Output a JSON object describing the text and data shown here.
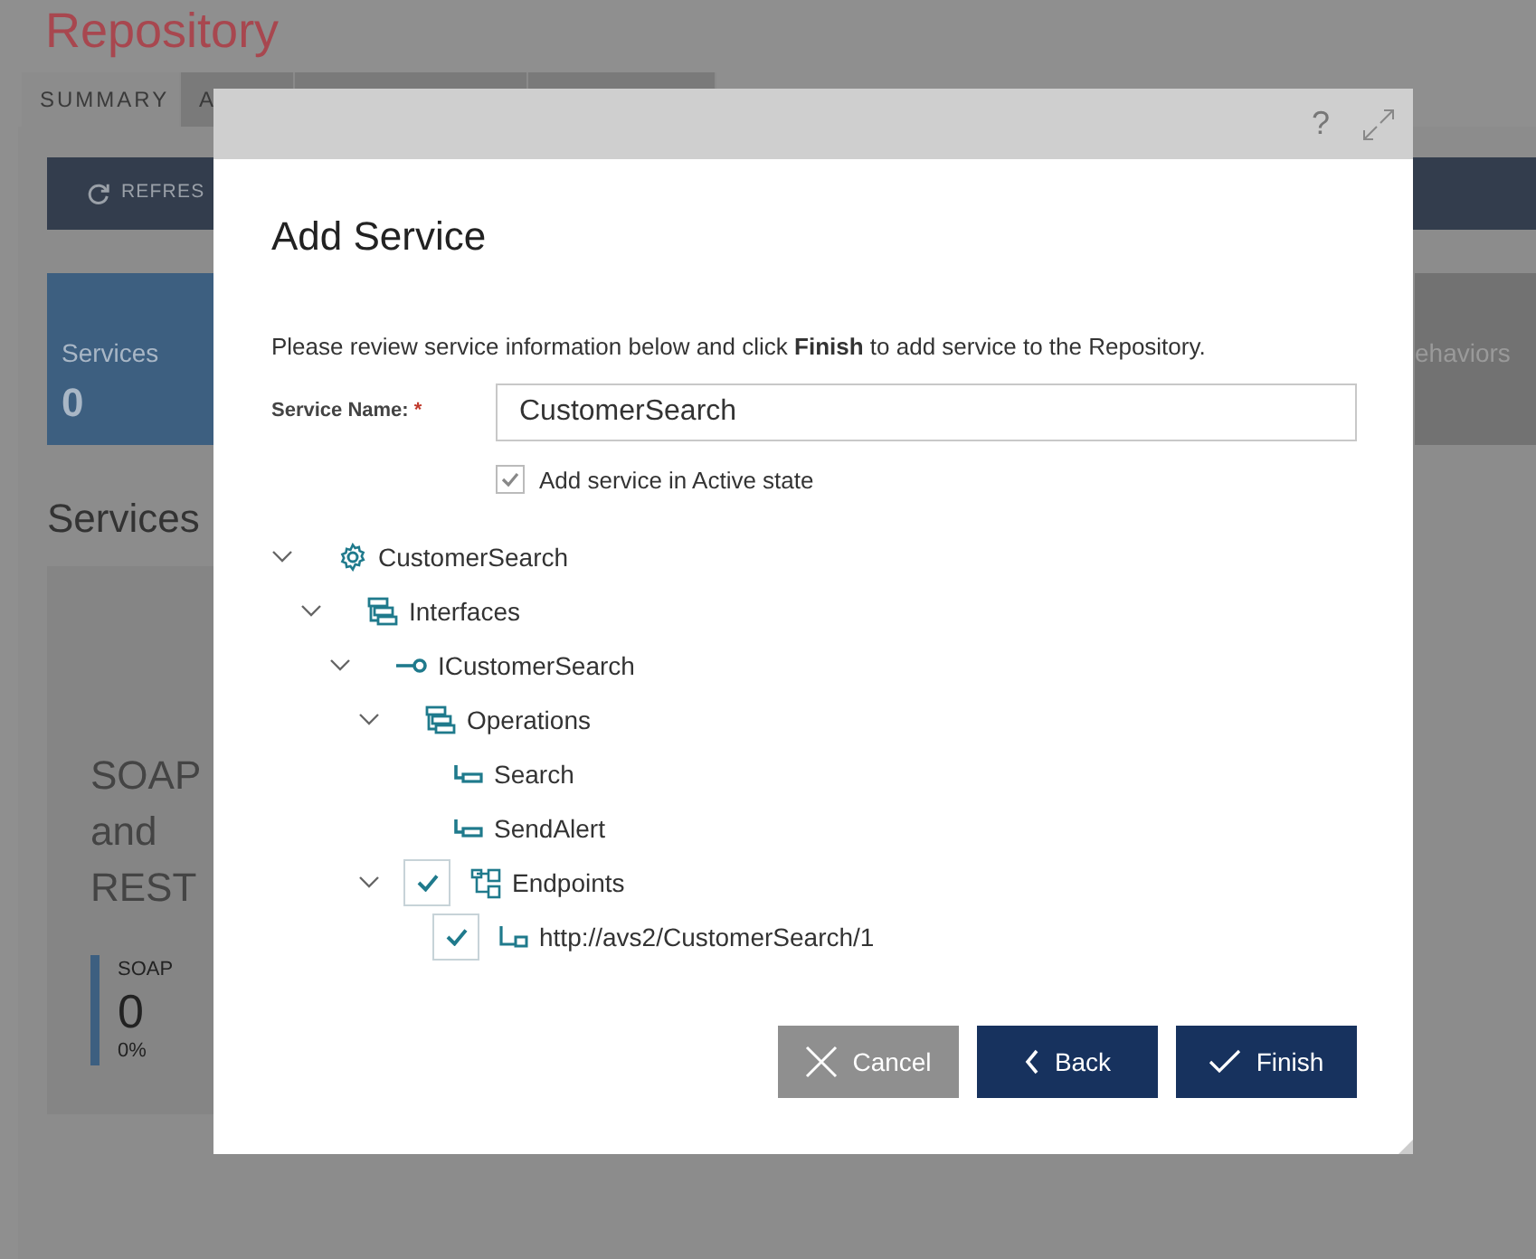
{
  "page": {
    "title": "Repository",
    "tabs": [
      {
        "label": "SUMMARY",
        "selected": true
      },
      {
        "label": "A",
        "selected": false
      },
      {
        "selected": false
      },
      {
        "selected": false
      }
    ],
    "toolbar": {
      "refresh_label": "REFRES"
    },
    "tiles": [
      {
        "label": "Services",
        "value": "0",
        "color": "#3d5f80"
      },
      {
        "label": "ehaviors",
        "color": "#727272"
      }
    ],
    "section_title": "Services",
    "card": {
      "title": "SOAP and REST",
      "stat": {
        "label": "SOAP",
        "value": "0",
        "percent": "0%"
      }
    }
  },
  "dialog": {
    "help": "?",
    "title": "Add Service",
    "message": "Please review service information below and click **Finish** to add service to the Repository.",
    "field": {
      "label": "Service Name:",
      "required_mark": "*",
      "value": "CustomerSearch"
    },
    "active_checkbox": {
      "label": "Add service in Active state",
      "checked": true
    },
    "tree": [
      {
        "label": "CustomerSearch",
        "kind": "service",
        "expanded": true,
        "children": [
          {
            "label": "Interfaces",
            "kind": "folder",
            "expanded": true,
            "children": [
              {
                "label": "ICustomerSearch",
                "kind": "interface",
                "expanded": true,
                "children": [
                  {
                    "label": "Operations",
                    "kind": "folder",
                    "expanded": true,
                    "children": [
                      {
                        "label": "Search",
                        "kind": "operation"
                      },
                      {
                        "label": "SendAlert",
                        "kind": "operation"
                      }
                    ]
                  },
                  {
                    "label": "Endpoints",
                    "kind": "endpoints",
                    "expanded": true,
                    "checked": true,
                    "children": [
                      {
                        "label": "http://avs2/CustomerSearch/1",
                        "kind": "endpoint",
                        "checked": true
                      }
                    ]
                  }
                ]
              }
            ]
          }
        ]
      }
    ],
    "buttons": [
      {
        "label": "Cancel",
        "kind": "cancel"
      },
      {
        "label": "Back",
        "kind": "back"
      },
      {
        "label": "Finish",
        "kind": "finish"
      }
    ]
  }
}
